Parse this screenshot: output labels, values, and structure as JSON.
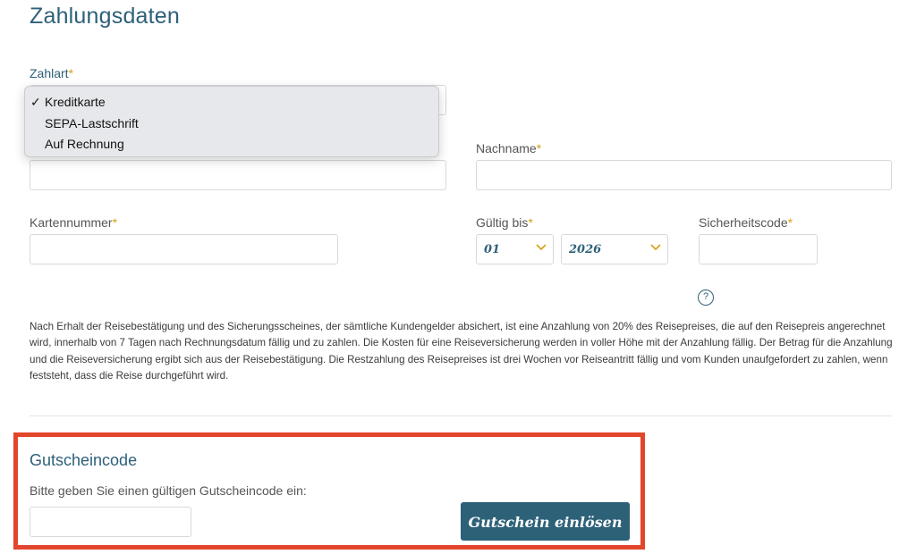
{
  "page": {
    "title": "Zahlungsdaten"
  },
  "payment": {
    "zahlart_label": "Zahlart",
    "required_mark": "*",
    "options": [
      "Kreditkarte",
      "SEPA-Lastschrift",
      "Auf Rechnung"
    ],
    "selected_index": 0,
    "check_glyph": "✓"
  },
  "fields": {
    "nachname_label": "Nachname",
    "kartennummer_label": "Kartennummer",
    "gueltig_label": "Gültig bis",
    "month_value": "01",
    "year_value": "2026",
    "sicherheitscode_label": "Sicherheitscode",
    "help_glyph": "?"
  },
  "info_text": "Nach Erhalt der Reisebestätigung und des Sicherungsscheines, der sämtliche Kundengelder absichert, ist eine Anzahlung von 20% des Reisepreises, die auf den Reisepreis angerechnet wird, innerhalb von 7 Tagen nach Rechnungsdatum fällig und zu zahlen. Die Kosten für eine Reiseversicherung werden in voller Höhe mit der Anzahlung fällig. Der Betrag für die Anzahlung und die Reiseversicherung ergibt sich aus der Reisebestätigung. Die Restzahlung des Reisepreises ist drei Wochen vor Reiseantritt fällig und vom Kunden unaufgefordert zu zahlen, wenn feststeht, dass die Reise durchgeführt wird.",
  "voucher": {
    "title": "Gutscheincode",
    "help_text": "Bitte geben Sie einen gültigen Gutscheincode ein:",
    "input_value": "",
    "button_label": "Gutschein einlösen"
  },
  "colors": {
    "accent": "#2e6079",
    "required": "#d4a017",
    "highlight": "#e2462c",
    "button": "#2d6178"
  },
  "icons": {
    "chevron": "chevron-down-icon",
    "check": "checkmark-icon",
    "help": "help-icon"
  }
}
